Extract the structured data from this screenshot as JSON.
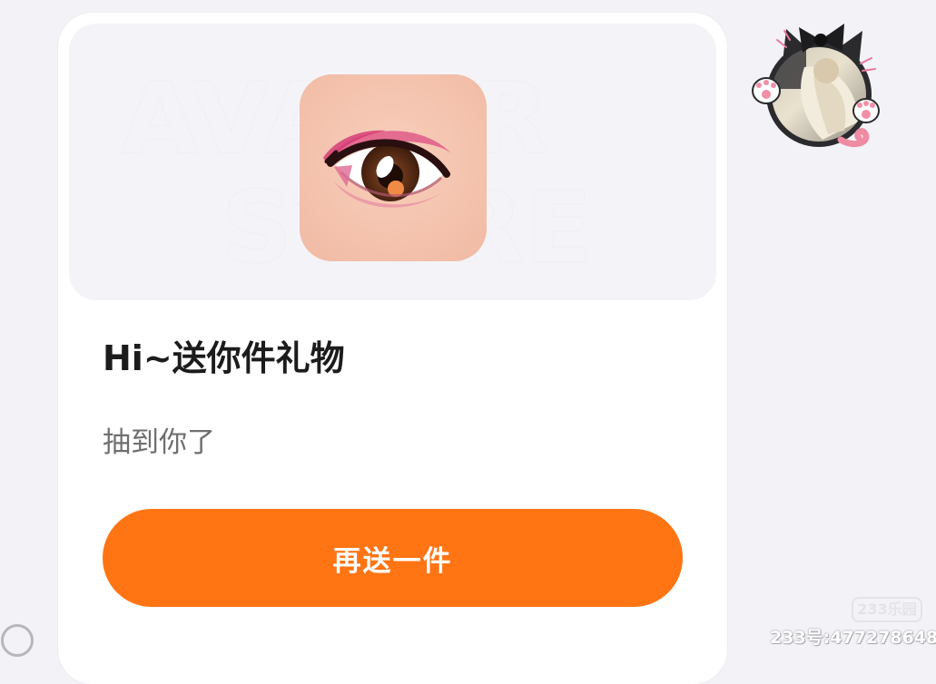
{
  "card": {
    "watermark_line1": "AVATAR",
    "watermark_line2": "STORE",
    "item_icon": "eye-makeup-icon",
    "title": "Hi~送你件礼物",
    "subtitle": "抽到你了",
    "button_label": "再送一件"
  },
  "sender": {
    "avatar_icon": "cat-frame-avatar"
  },
  "overlay": {
    "logo": "233乐园",
    "id_text": "233号:477278648"
  },
  "colors": {
    "background": "#f2f2f7",
    "card": "#ffffff",
    "banner": "#f4f4f8",
    "accent": "#ff7413",
    "title": "#1c1c1c",
    "subtitle": "#6f6f72"
  }
}
